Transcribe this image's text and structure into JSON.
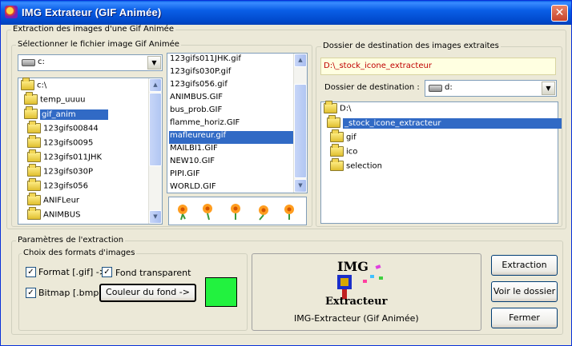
{
  "window": {
    "title": "IMG Extrateur (GIF Animée)"
  },
  "main_group": {
    "legend": "Extraction des images d'une Gif Animée"
  },
  "source": {
    "legend": "Sélectionner le fichier image Gif Animée",
    "drive_value": "c:",
    "tree": [
      {
        "label": "c:\\"
      },
      {
        "label": "temp_uuuu"
      },
      {
        "label": "gif_anim"
      },
      {
        "label": "123gifs00844"
      },
      {
        "label": "123gifs0095"
      },
      {
        "label": "123gifs011JHK"
      },
      {
        "label": "123gifs030P"
      },
      {
        "label": "123gifs056"
      },
      {
        "label": "ANIFLeur"
      },
      {
        "label": "ANIMBUS"
      }
    ],
    "files": [
      "123gifs011JHK.gif",
      "123gifs030P.gif",
      "123gifs056.gif",
      "ANIMBUS.GIF",
      "bus_prob.GIF",
      "flamme_horiz.GIF",
      "mafleureur.gif",
      "MAILBI1.GIF",
      "NEW10.GIF",
      "PIPI.GIF",
      "WORLD.GIF"
    ],
    "selected_file": "mafleureur.gif"
  },
  "destination": {
    "legend": "Dossier de destination des images extraites",
    "path": "D:\\_stock_icone_extracteur",
    "label": "Dossier de destination :",
    "drive_value": "d:",
    "tree": [
      {
        "label": "D:\\"
      },
      {
        "label": "_stock_icone_extracteur"
      },
      {
        "label": "gif"
      },
      {
        "label": "ico"
      },
      {
        "label": "selection"
      }
    ]
  },
  "params": {
    "legend": "Paramètres de l'extraction",
    "formats_legend": "Choix des formats d'images",
    "format_gif": "Format [.gif] ->",
    "transparent": "Fond transparent",
    "bitmap": "Bitmap [.bmp]",
    "color_button": "Couleur du fond ->",
    "color_swatch": "#22f23f"
  },
  "logo": {
    "title": "IMG",
    "subtitle": "Extracteur",
    "caption": "IMG-Extracteur (Gif Animée)"
  },
  "buttons": {
    "extraction": "Extraction",
    "view_folder": "Voir le dossier",
    "close": "Fermer"
  },
  "colors": {
    "accent": "#316ac5",
    "path_bg": "#ffffe1",
    "path_text": "#c00000"
  }
}
